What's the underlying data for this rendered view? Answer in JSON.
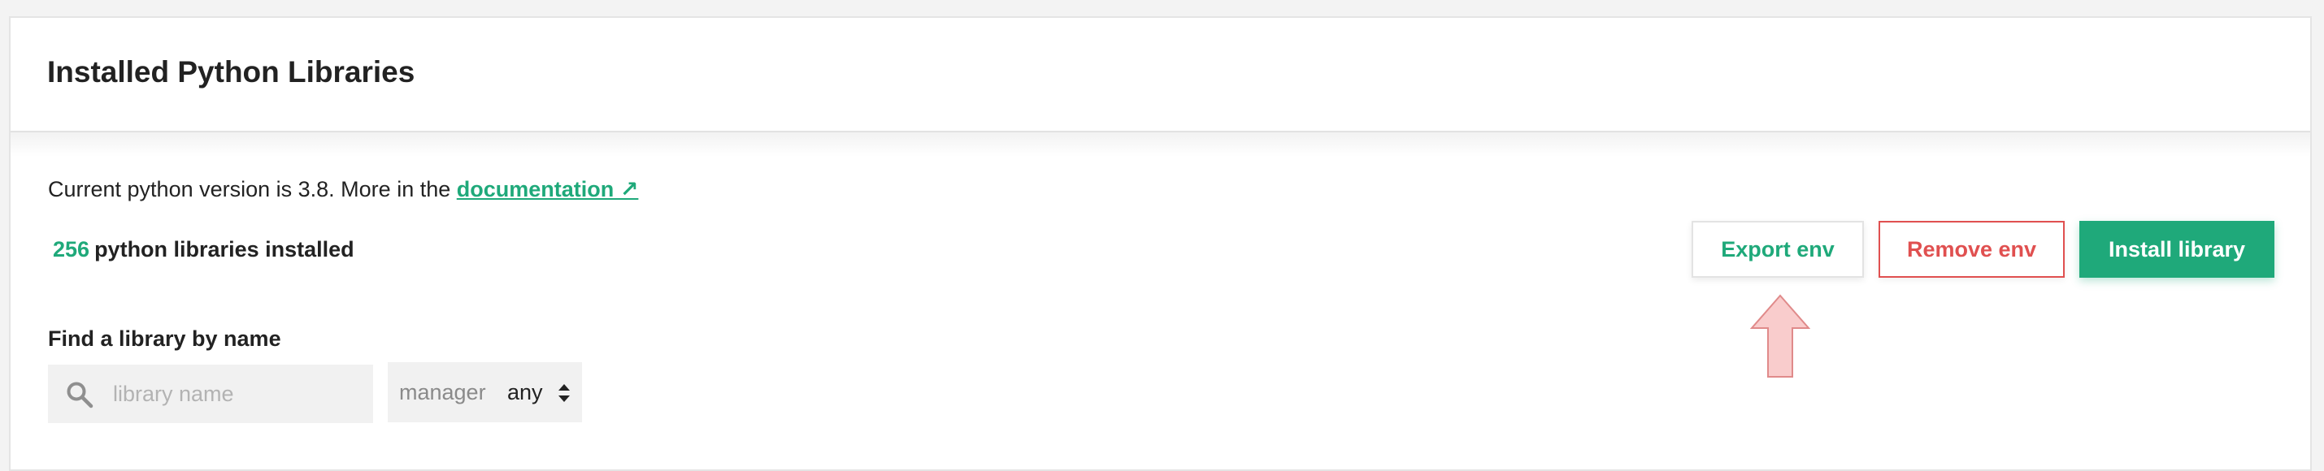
{
  "header": {
    "title": "Installed Python Libraries"
  },
  "info": {
    "version_text": "Current python version is 3.8. More in the ",
    "doc_link": "documentation ↗"
  },
  "summary": {
    "count": "256",
    "count_suffix": "python libraries installed"
  },
  "actions": {
    "export_label": "Export env",
    "remove_label": "Remove env",
    "install_label": "Install library"
  },
  "search": {
    "label": "Find a library by name",
    "placeholder": "library name",
    "value": ""
  },
  "manager": {
    "label": "manager",
    "value": "any"
  },
  "colors": {
    "accent": "#1fa97a",
    "danger": "#e05050",
    "arrow_fill": "#f9cccc",
    "arrow_stroke": "#e08a8a"
  },
  "icons": {
    "search": "search-icon",
    "sort": "sort-icon",
    "annotation": "up-arrow-icon"
  }
}
